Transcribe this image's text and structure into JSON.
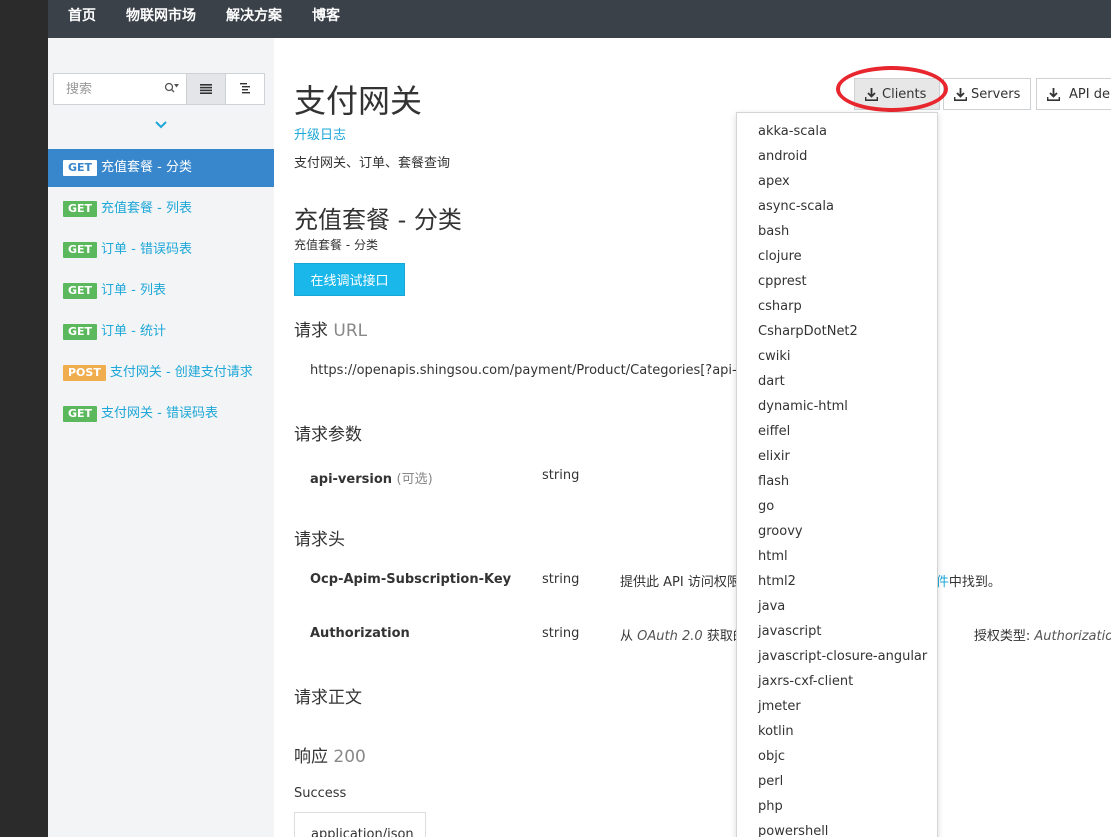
{
  "topnav": {
    "items": [
      "首页",
      "物联网市场",
      "解决方案",
      "博客"
    ]
  },
  "sidebar": {
    "search_placeholder": "搜索",
    "items": [
      {
        "method": "GET",
        "label": "充值套餐 - 分类",
        "active": true
      },
      {
        "method": "GET",
        "label": "充值套餐 - 列表"
      },
      {
        "method": "GET",
        "label": "订单 - 错误码表"
      },
      {
        "method": "GET",
        "label": "订单 - 列表"
      },
      {
        "method": "GET",
        "label": "订单 - 统计"
      },
      {
        "method": "POST",
        "label": "支付网关 - 创建支付请求"
      },
      {
        "method": "GET",
        "label": "支付网关 - 错误码表"
      }
    ]
  },
  "main": {
    "api_title": "支付网关",
    "changelog": "升级日志",
    "api_description": "支付网关、订单、套餐查询",
    "operation_title": "充值套餐 - 分类",
    "operation_description": "充值套餐 - 分类",
    "try_button": "在线调试接口",
    "request_url_heading": "请求",
    "request_url_suffix": "URL",
    "request_url": "https://openapis.shingsou.com/payment/Product/Categories[?api-ver",
    "params_heading": "请求参数",
    "params": [
      {
        "name": "api-version",
        "optional": "(可选)",
        "type": "string"
      }
    ],
    "headers_heading": "请求头",
    "headers": [
      {
        "name": "Ocp-Apim-Subscription-Key",
        "type": "string",
        "desc": "提供此 API 访问权限",
        "desc_link": "件",
        "desc_tail": "中找到。"
      },
      {
        "name": "Authorization",
        "type": "string",
        "desc": "从",
        "desc_em": "OAuth 2.0",
        "desc_mid": "获取的",
        "desc_tail": "授权类型:",
        "desc_em2": "Authorization code,"
      }
    ],
    "body_heading": "请求正文",
    "response_heading": "响应",
    "response_code": "200",
    "response_desc": "Success",
    "content_type": "application/json"
  },
  "toolbar": {
    "clients": "Clients",
    "servers": "Servers",
    "api_definition": "API de"
  },
  "clients_dropdown": {
    "options": [
      "akka-scala",
      "android",
      "apex",
      "async-scala",
      "bash",
      "clojure",
      "cpprest",
      "csharp",
      "CsharpDotNet2",
      "cwiki",
      "dart",
      "dynamic-html",
      "eiffel",
      "elixir",
      "flash",
      "go",
      "groovy",
      "html",
      "html2",
      "java",
      "javascript",
      "javascript-closure-angular",
      "jaxrs-cxf-client",
      "jmeter",
      "kotlin",
      "objc",
      "perl",
      "php",
      "powershell"
    ]
  },
  "colors": {
    "accent": "#1ea7d8",
    "active_nav": "#3887cc",
    "get_badge": "#5cb85c",
    "post_badge": "#f0ad4e",
    "highlight_ring": "#e8262e"
  }
}
